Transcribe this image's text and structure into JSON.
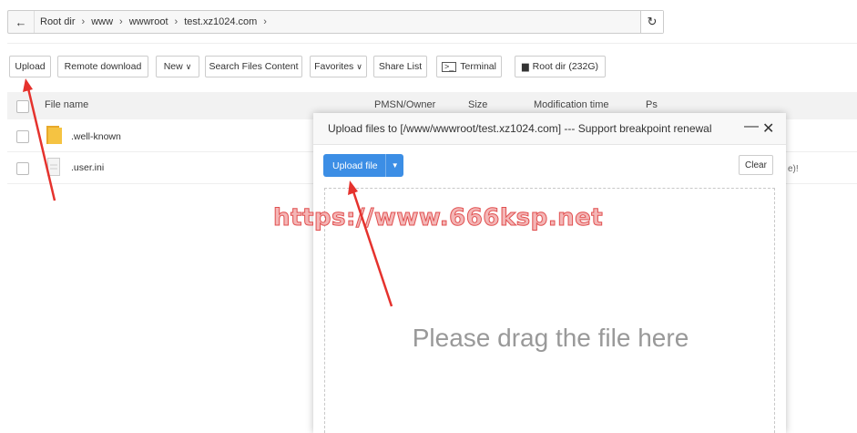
{
  "pathbar": {
    "back_icon": "arrow-left-icon",
    "crumbs": [
      "Root dir",
      "www",
      "wwwroot",
      "test.xz1024.com"
    ],
    "separator": ">",
    "refresh_icon": "refresh-icon"
  },
  "toolbar": {
    "upload": "Upload",
    "remote_download": "Remote download",
    "new": "New",
    "search": "Search Files Content",
    "favorites": "Favorites",
    "share_list": "Share List",
    "terminal": "Terminal",
    "root_dir": "Root dir (232G)"
  },
  "table": {
    "headers": {
      "name": "File name",
      "perm": "PMSN/Owner",
      "size": "Size",
      "mtime": "Modification time",
      "ps": "Ps"
    },
    "rows": [
      {
        "name": ".well-known",
        "type": "folder"
      },
      {
        "name": ".user.ini",
        "type": "file",
        "ps_partial": "e)!"
      }
    ]
  },
  "dialog": {
    "title": "Upload files to [/www/wwwroot/test.xz1024.com] --- Support breakpoint renewal",
    "minimize": "—",
    "close": "✕",
    "upload_button": "Upload file",
    "clear_button": "Clear",
    "drop_text": "Please drag the file here"
  },
  "watermark": "https://www.666ksp.net",
  "colors": {
    "accent": "#3c8ee5",
    "arrow": "#e5322d",
    "folder": "#f5c342"
  }
}
